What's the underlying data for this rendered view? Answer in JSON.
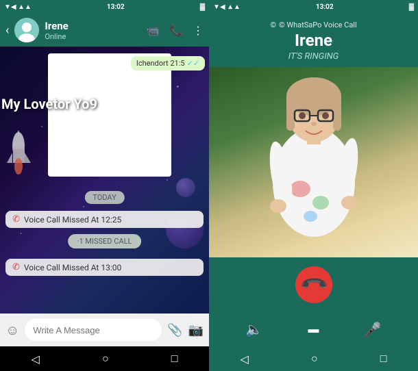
{
  "left": {
    "status_bar": {
      "time": "13:02",
      "icons": "▼◀ ▲▲▲"
    },
    "header": {
      "back": "‹",
      "name": "Irene",
      "status": "Online",
      "actions": [
        "📹",
        "📞",
        "⋮"
      ]
    },
    "chat": {
      "sent_message": "Ichendort 21:5",
      "overlay_text": "My Lovetor Yo9",
      "today_label": "TODAY",
      "missed_call_1": "Voice Call Missed At 12:25",
      "missed_call_badge": "·1 MISSED CALL",
      "missed_call_2": "Voice Call Missed At 13:00"
    },
    "input": {
      "placeholder": "Write A Message"
    },
    "nav": {
      "back": "◁",
      "home": "○",
      "square": "□"
    }
  },
  "right": {
    "status_bar": {
      "time": "13:02"
    },
    "call": {
      "app_label": "© WhatSaPo Voice Call",
      "caller_name": "Irene",
      "status": "IT'S RINGING"
    },
    "nav": {
      "back": "◁",
      "home": "○",
      "square": "□"
    },
    "bottom_icons": {
      "speaker": "🔈",
      "video": "▬",
      "mute": "🎤"
    }
  }
}
